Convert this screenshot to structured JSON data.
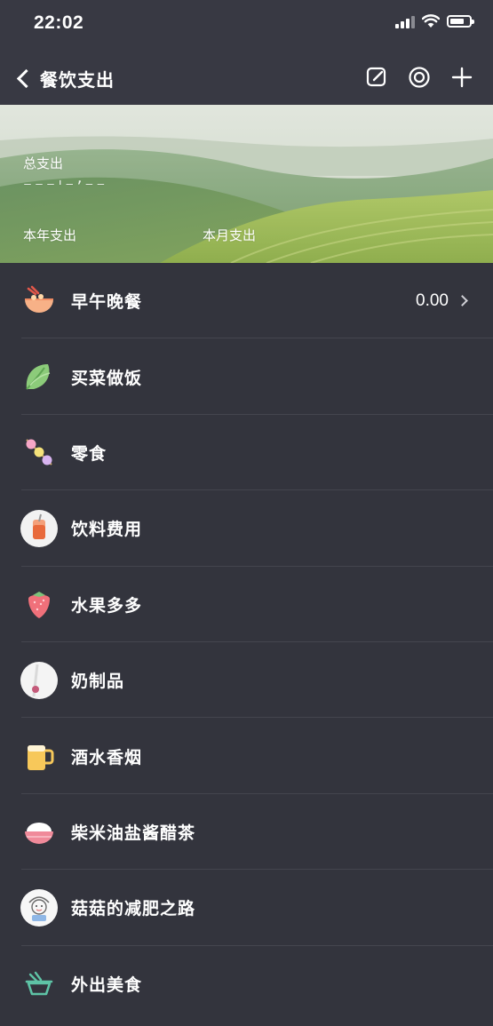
{
  "status": {
    "time": "22:02"
  },
  "nav": {
    "back_label": "餐饮支出",
    "actions": [
      "edit-icon",
      "target-icon",
      "plus-icon"
    ]
  },
  "hero": {
    "total_label": "总支出",
    "total_value": "⁻⁻⁻ˈ⁻ʼ⁻⁻",
    "year_label": "本年支出",
    "month_label": "本月支出"
  },
  "categories": [
    {
      "label": "早午晚餐",
      "icon": "noodle-bowl-icon",
      "amount": "0.00"
    },
    {
      "label": "买菜做饭",
      "icon": "vegetable-leaf-icon"
    },
    {
      "label": "零食",
      "icon": "candy-skewer-icon"
    },
    {
      "label": "饮料费用",
      "icon": "drink-cup-icon"
    },
    {
      "label": "水果多多",
      "icon": "strawberry-icon"
    },
    {
      "label": "奶制品",
      "icon": "milk-icon"
    },
    {
      "label": "酒水香烟",
      "icon": "beer-mug-icon"
    },
    {
      "label": "柴米油盐酱醋茶",
      "icon": "rice-bowl-icon"
    },
    {
      "label": "菇菇的减肥之路",
      "icon": "cartoon-avatar-icon"
    },
    {
      "label": "外出美食",
      "icon": "takeout-bowl-icon"
    }
  ],
  "colors": {
    "background": "#33343d",
    "nav_background": "#383943",
    "divider": "#44454e"
  }
}
